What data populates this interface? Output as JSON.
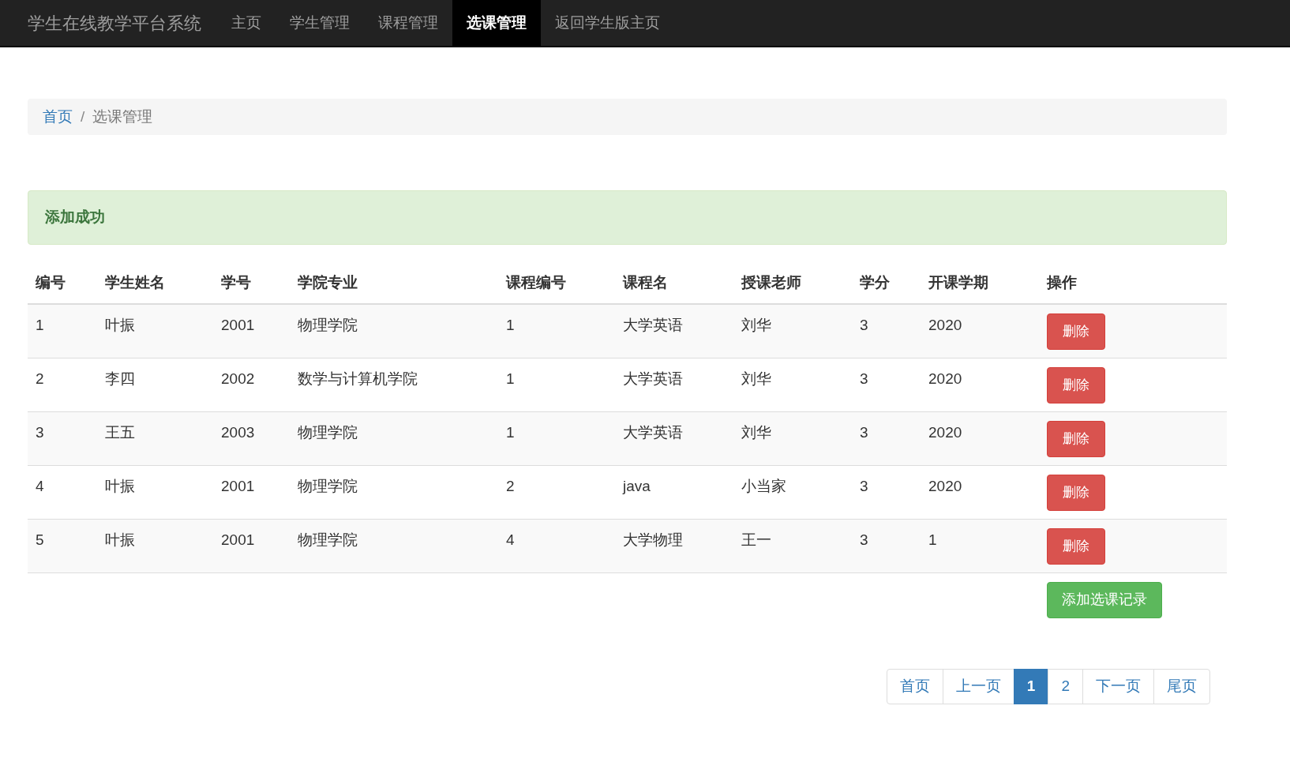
{
  "navbar": {
    "brand": "学生在线教学平台系统",
    "items": [
      {
        "label": "主页",
        "selected": false
      },
      {
        "label": "学生管理",
        "selected": false
      },
      {
        "label": "课程管理",
        "selected": false
      },
      {
        "label": "选课管理",
        "selected": true
      },
      {
        "label": "返回学生版主页",
        "selected": false
      }
    ]
  },
  "breadcrumb": {
    "separator": "/",
    "items": [
      {
        "label": "首页",
        "kind": "link"
      },
      {
        "label": "选课管理",
        "kind": "current"
      }
    ]
  },
  "alert": {
    "text": "添加成功"
  },
  "table": {
    "columns": [
      "编号",
      "学生姓名",
      "学号",
      "学院专业",
      "课程编号",
      "课程名",
      "授课老师",
      "学分",
      "开课学期",
      "操作"
    ],
    "rows": [
      {
        "cells": [
          "1",
          "叶振",
          "2001",
          "物理学院",
          "1",
          "大学英语",
          "刘华",
          "3",
          "2020"
        ],
        "action": "删除"
      },
      {
        "cells": [
          "2",
          "李四",
          "2002",
          "数学与计算机学院",
          "1",
          "大学英语",
          "刘华",
          "3",
          "2020"
        ],
        "action": "删除"
      },
      {
        "cells": [
          "3",
          "王五",
          "2003",
          "物理学院",
          "1",
          "大学英语",
          "刘华",
          "3",
          "2020"
        ],
        "action": "删除"
      },
      {
        "cells": [
          "4",
          "叶振",
          "2001",
          "物理学院",
          "2",
          "java",
          "小当家",
          "3",
          "2020"
        ],
        "action": "删除"
      },
      {
        "cells": [
          "5",
          "叶振",
          "2001",
          "物理学院",
          "4",
          "大学物理",
          "王一",
          "3",
          "1"
        ],
        "action": "删除"
      }
    ]
  },
  "add_button": "添加选课记录",
  "pagination": [
    {
      "label": "首页",
      "selected": false
    },
    {
      "label": "上一页",
      "selected": false
    },
    {
      "label": "1",
      "selected": true
    },
    {
      "label": "2",
      "selected": false
    },
    {
      "label": "下一页",
      "selected": false
    },
    {
      "label": "尾页",
      "selected": false
    }
  ]
}
